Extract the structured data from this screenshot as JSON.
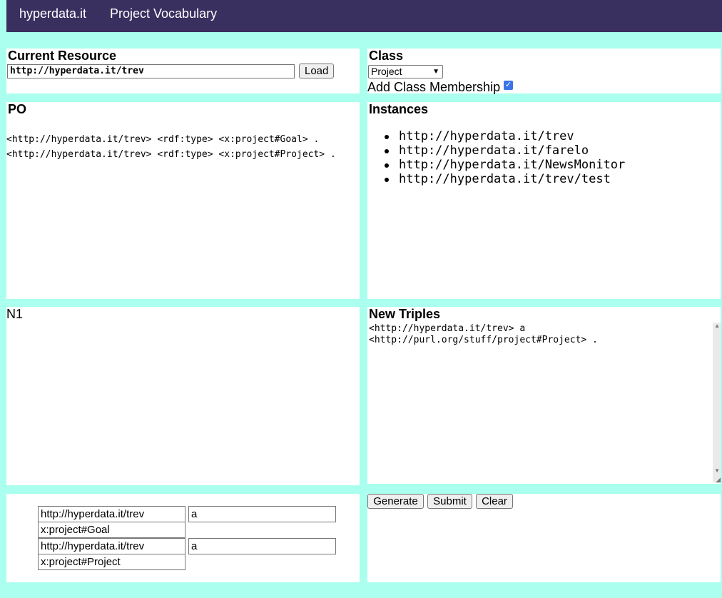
{
  "nav": {
    "items": [
      "hyperdata.it",
      "Project Vocabulary"
    ]
  },
  "current_resource": {
    "heading": "Current Resource",
    "value": "http://hyperdata.it/trev",
    "load_label": "Load"
  },
  "class_panel": {
    "heading": "Class",
    "selected": "Project",
    "membership_label": "Add Class Membership",
    "membership_checked": true
  },
  "po": {
    "heading": "PO",
    "triples": [
      "<http://hyperdata.it/trev> <rdf:type> <x:project#Goal> .",
      "<http://hyperdata.it/trev> <rdf:type> <x:project#Project> ."
    ]
  },
  "instances": {
    "heading": "Instances",
    "items": [
      "http://hyperdata.it/trev",
      "http://hyperdata.it/farelo",
      "http://hyperdata.it/NewsMonitor",
      "http://hyperdata.it/trev/test"
    ]
  },
  "n1": {
    "label": "N1"
  },
  "new_triples": {
    "heading": "New Triples",
    "text": "<http://hyperdata.it/trev> a\n<http://purl.org/stuff/project#Project> ."
  },
  "editor_rows": [
    {
      "subject": "http://hyperdata.it/trev",
      "predicate": "a",
      "object": "x:project#Goal"
    },
    {
      "subject": "http://hyperdata.it/trev",
      "predicate": "a",
      "object": "x:project#Project"
    }
  ],
  "actions": {
    "generate": "Generate",
    "submit": "Submit",
    "clear": "Clear"
  }
}
